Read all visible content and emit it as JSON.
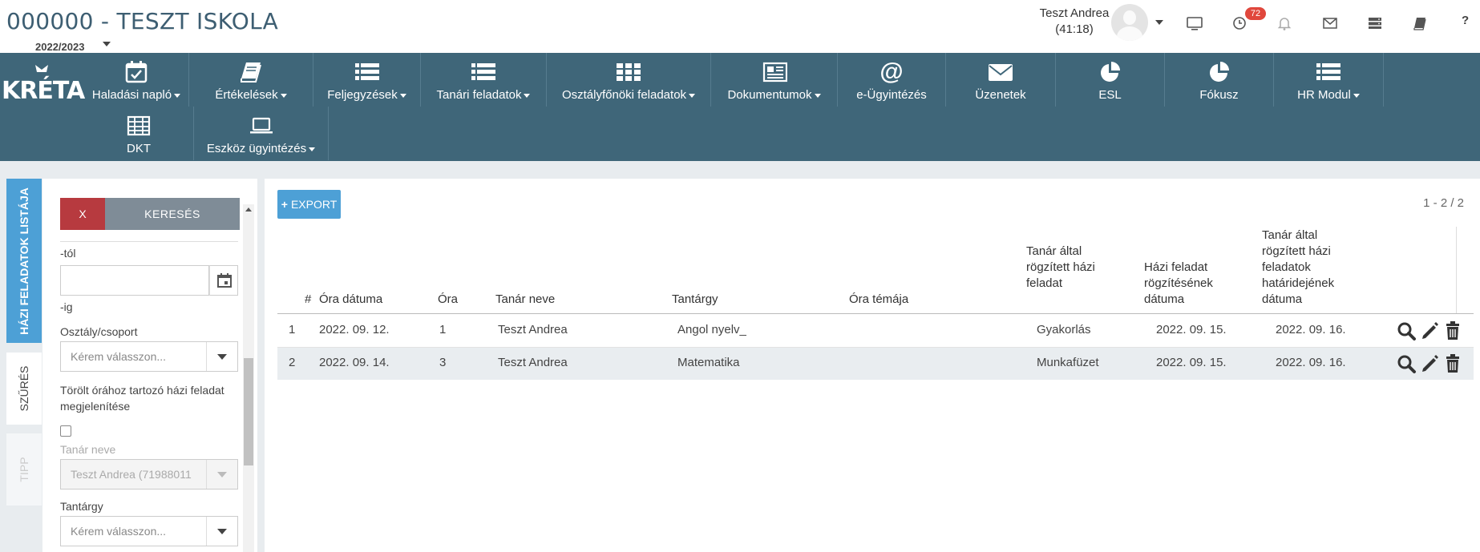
{
  "header": {
    "school_title": "000000 - TESZT ISKOLA",
    "school_year": "2022/2023",
    "user_name": "Teszt Andrea",
    "session_time": "(41:18)",
    "notification_count": "72",
    "icons": [
      "monitor-icon",
      "clock-icon",
      "bell-icon",
      "envelope-icon",
      "server-icon",
      "book-icon",
      "help-icon"
    ],
    "help_label": "?"
  },
  "nav": {
    "logo": "KRÉTA",
    "items": [
      {
        "label": "Haladási napló",
        "icon": "calendar-check-icon",
        "dropdown": true
      },
      {
        "label": "Értékelések",
        "icon": "book-icon",
        "dropdown": true
      },
      {
        "label": "Feljegyzések",
        "icon": "list-icon",
        "dropdown": true
      },
      {
        "label": "Tanári feladatok",
        "icon": "list-icon",
        "dropdown": true
      },
      {
        "label": "Osztályfőnöki feladatok",
        "icon": "grid-icon",
        "dropdown": true
      },
      {
        "label": "Dokumentumok",
        "icon": "newspaper-icon",
        "dropdown": true
      },
      {
        "label": "e-Ügyintézés",
        "icon": "at-icon",
        "dropdown": false
      },
      {
        "label": "Üzenetek",
        "icon": "envelope-icon",
        "dropdown": false
      },
      {
        "label": "ESL",
        "icon": "pie-chart-icon",
        "dropdown": false
      },
      {
        "label": "Fókusz",
        "icon": "pie-chart-icon",
        "dropdown": false
      },
      {
        "label": "HR Modul",
        "icon": "list-icon",
        "dropdown": true
      },
      {
        "label": "DKT",
        "icon": "table-icon",
        "dropdown": false
      },
      {
        "label": "Eszköz ügyintézés",
        "icon": "laptop-icon",
        "dropdown": true
      }
    ]
  },
  "side_tabs": {
    "list": "HÁZI FELADATOK LISTÁJA",
    "filter": "SZŰRÉS",
    "tip": "TIPP"
  },
  "filter": {
    "clear_label": "X",
    "search_label": "KERESÉS",
    "from_label": "-tól",
    "from_value": "",
    "to_label": "-ig",
    "class_label": "Osztály/csoport",
    "class_placeholder": "Kérem válasszon...",
    "deleted_label": "Törölt órához tartozó házi feladat megjelenítése",
    "deleted_checked": false,
    "teacher_label": "Tanár neve",
    "teacher_value": "Teszt Andrea (71988011",
    "subject_label": "Tantárgy",
    "subject_placeholder": "Kérem válasszon..."
  },
  "content": {
    "export_label": "EXPORT",
    "pager": "1 - 2 / 2",
    "columns": {
      "num": "#",
      "date": "Óra dátuma",
      "lesson": "Óra",
      "teacher": "Tanár neve",
      "subject": "Tantárgy",
      "topic": "Óra témája",
      "homework_l1": "Tanár által",
      "homework_l2": "rögzített házi",
      "homework_l3": "feladat",
      "recorded_l1": "Házi feladat",
      "recorded_l2": "rögzítésének",
      "recorded_l3": "dátuma",
      "deadline_l1": "Tanár által",
      "deadline_l2": "rögzített házi",
      "deadline_l3": "feladatok",
      "deadline_l4": "határidejének",
      "deadline_l5": "dátuma"
    },
    "rows": [
      {
        "num": "1",
        "date": "2022. 09. 12.",
        "lesson": "1",
        "teacher": "Teszt Andrea",
        "subject": "Angol nyelv_",
        "topic": "",
        "homework": "Gyakorlás",
        "recorded": "2022. 09. 15.",
        "deadline": "2022. 09. 16."
      },
      {
        "num": "2",
        "date": "2022. 09. 14.",
        "lesson": "3",
        "teacher": "Teszt Andrea",
        "subject": "Matematika",
        "topic": "",
        "homework": "Munkafüzet",
        "recorded": "2022. 09. 15.",
        "deadline": "2022. 09. 16."
      }
    ]
  },
  "colors": {
    "nav_bg": "#3f6679",
    "title_color": "#3d5e72",
    "danger": "#b73a3f",
    "export_blue": "#4da0d6",
    "tab_blue": "#4da0d6"
  }
}
